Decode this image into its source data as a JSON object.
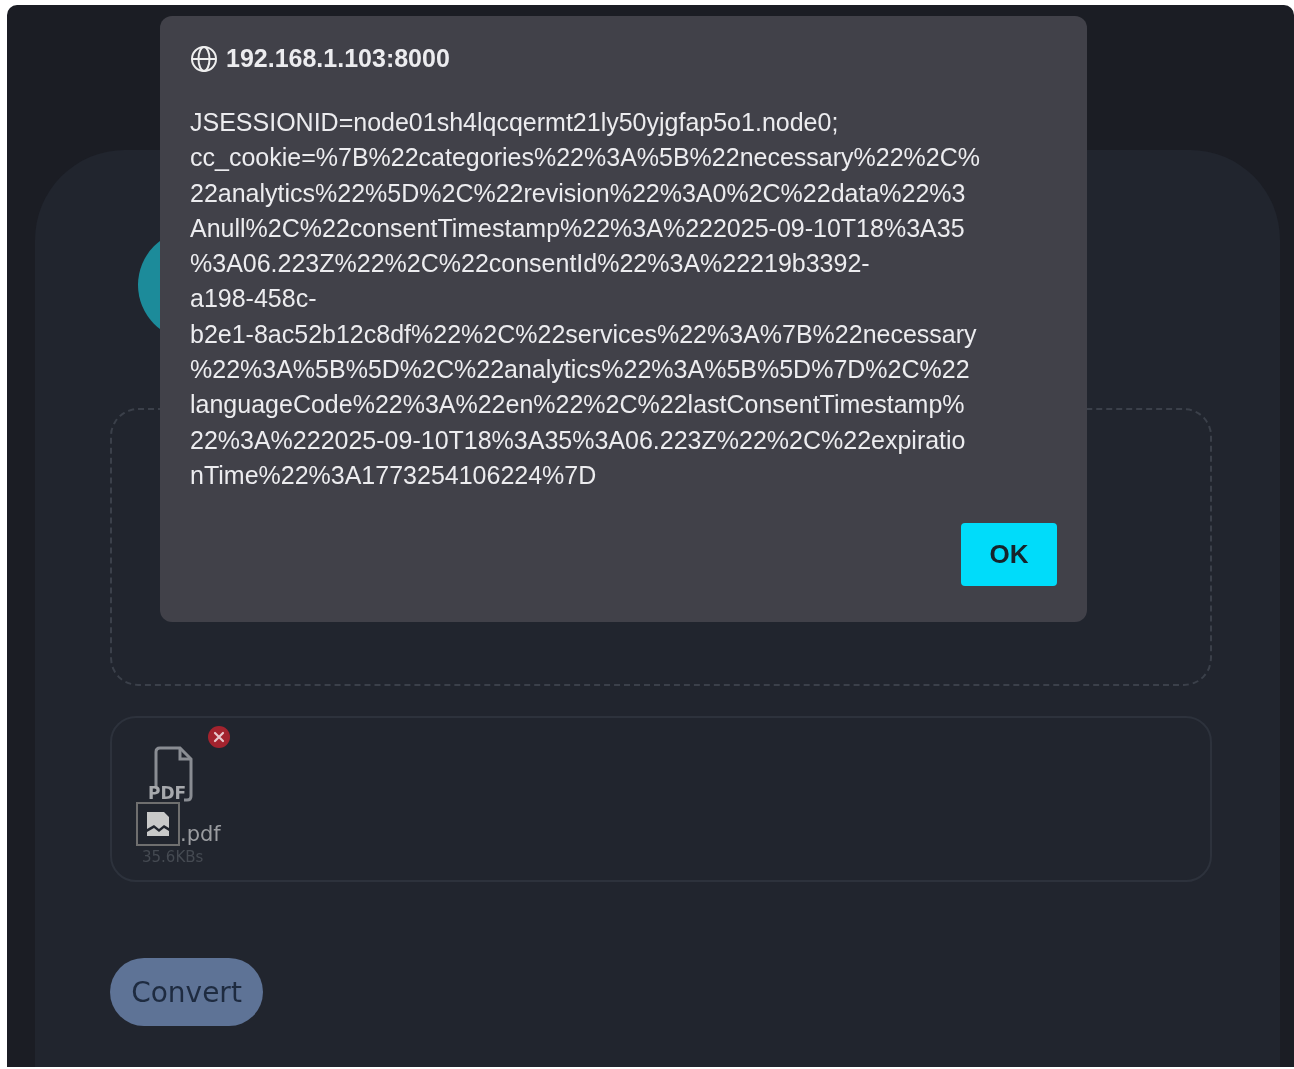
{
  "dialog": {
    "title": "192.168.1.103:8000",
    "message_lines": [
      "JSESSIONID=node01sh4lqcqermt21ly50yjgfap5o1.node0;",
      "cc_cookie=%7B%22categories%22%3A%5B%22necessary%22%2C%",
      "22analytics%22%5D%2C%22revision%22%3A0%2C%22data%22%3",
      "Anull%2C%22consentTimestamp%22%3A%222025-09-10T18%3A35",
      "%3A06.223Z%22%2C%22consentId%22%3A%22219b3392-",
      "a198-458c-",
      "b2e1-8ac52b12c8df%22%2C%22services%22%3A%7B%22necessary",
      "%22%3A%5B%5D%2C%22analytics%22%3A%5B%5D%7D%2C%22",
      "languageCode%22%3A%22en%22%2C%22lastConsentTimestamp%",
      "22%3A%222025-09-10T18%3A35%3A06.223Z%22%2C%22expiratio",
      "nTime%22%3A1773254106224%7D"
    ],
    "button": "OK"
  },
  "files": [
    {
      "type_label": "PDF",
      "name": ".pdf",
      "size": "35.6KBs"
    }
  ],
  "convert_button": "Convert"
}
